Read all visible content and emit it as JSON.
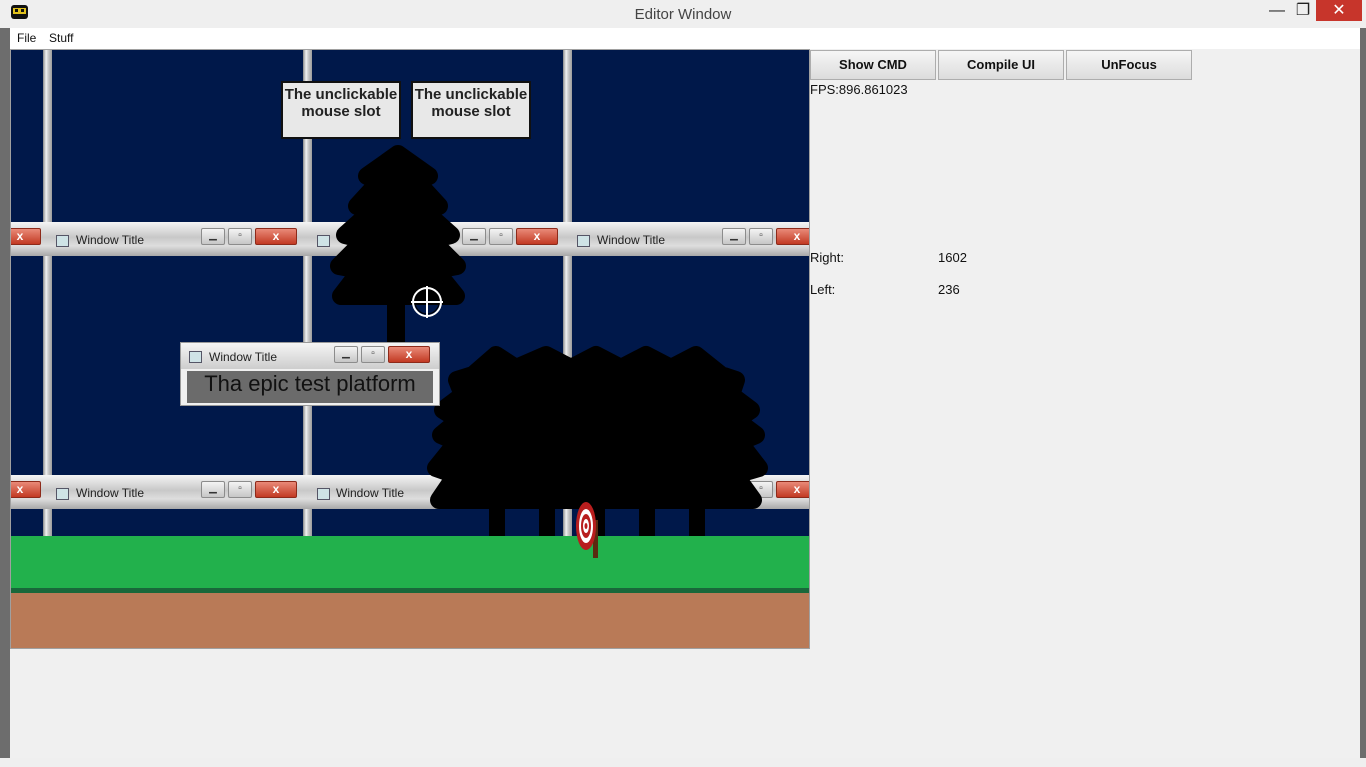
{
  "window": {
    "title": "Editor Window",
    "minimize": "—",
    "maximize": "❐",
    "close": "✕"
  },
  "menu": [
    "File",
    "Stuff"
  ],
  "viewport": {
    "window_title": "Window Title",
    "slot_label_1": "The unclickable mouse slot",
    "slot_label_2": "The unclickable mouse slot",
    "platform_text": "Tha epic test platform",
    "btn_min": "▁",
    "btn_max": "▫",
    "btn_close": "x"
  },
  "panel": {
    "buttons": [
      "Show CMD",
      "Compile UI",
      "UnFocus"
    ],
    "fps_label": "FPS:",
    "fps_value": "896.861023",
    "right_label": "Right:",
    "right_value": "1602",
    "left_label": "Left:",
    "left_value": "236"
  },
  "colors": {
    "sky": "#00184a",
    "grass": "#22b14c",
    "grass_edge": "#19683a",
    "dirt": "#b97a57",
    "close_red": "#c7352b"
  }
}
